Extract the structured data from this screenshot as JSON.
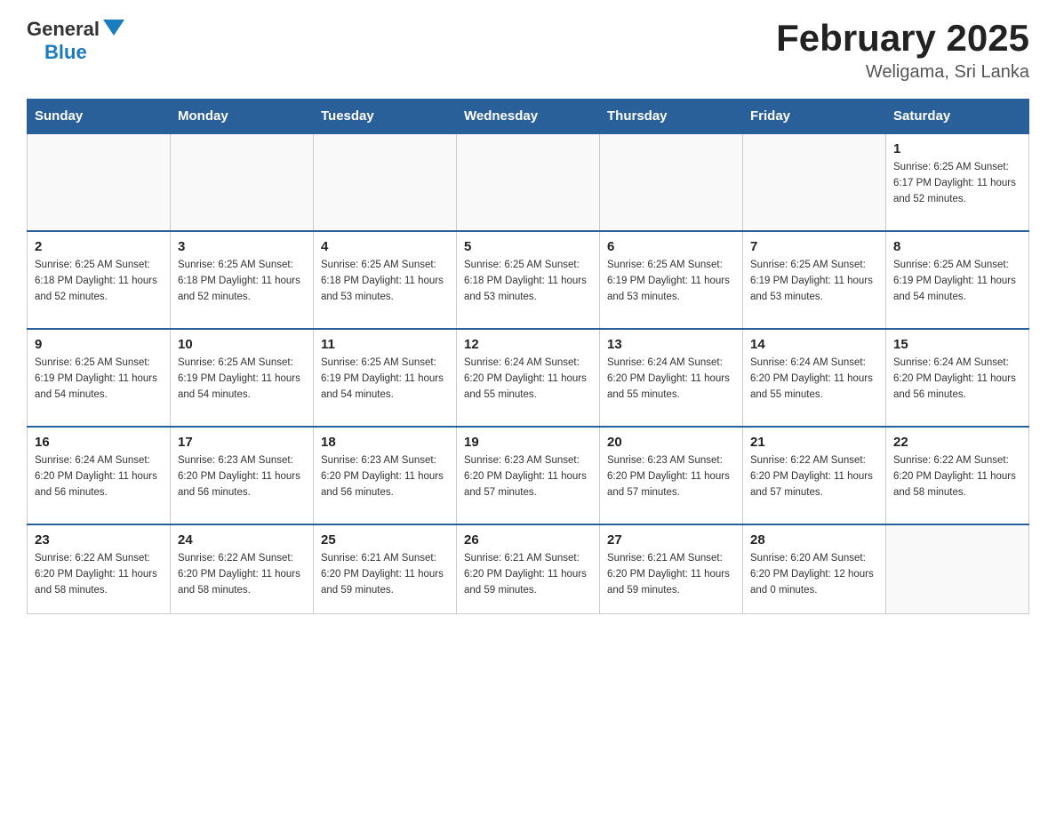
{
  "header": {
    "logo_general": "General",
    "logo_blue": "Blue",
    "title": "February 2025",
    "location": "Weligama, Sri Lanka"
  },
  "days_of_week": [
    "Sunday",
    "Monday",
    "Tuesday",
    "Wednesday",
    "Thursday",
    "Friday",
    "Saturday"
  ],
  "weeks": [
    [
      {
        "day": "",
        "info": ""
      },
      {
        "day": "",
        "info": ""
      },
      {
        "day": "",
        "info": ""
      },
      {
        "day": "",
        "info": ""
      },
      {
        "day": "",
        "info": ""
      },
      {
        "day": "",
        "info": ""
      },
      {
        "day": "1",
        "info": "Sunrise: 6:25 AM\nSunset: 6:17 PM\nDaylight: 11 hours\nand 52 minutes."
      }
    ],
    [
      {
        "day": "2",
        "info": "Sunrise: 6:25 AM\nSunset: 6:18 PM\nDaylight: 11 hours\nand 52 minutes."
      },
      {
        "day": "3",
        "info": "Sunrise: 6:25 AM\nSunset: 6:18 PM\nDaylight: 11 hours\nand 52 minutes."
      },
      {
        "day": "4",
        "info": "Sunrise: 6:25 AM\nSunset: 6:18 PM\nDaylight: 11 hours\nand 53 minutes."
      },
      {
        "day": "5",
        "info": "Sunrise: 6:25 AM\nSunset: 6:18 PM\nDaylight: 11 hours\nand 53 minutes."
      },
      {
        "day": "6",
        "info": "Sunrise: 6:25 AM\nSunset: 6:19 PM\nDaylight: 11 hours\nand 53 minutes."
      },
      {
        "day": "7",
        "info": "Sunrise: 6:25 AM\nSunset: 6:19 PM\nDaylight: 11 hours\nand 53 minutes."
      },
      {
        "day": "8",
        "info": "Sunrise: 6:25 AM\nSunset: 6:19 PM\nDaylight: 11 hours\nand 54 minutes."
      }
    ],
    [
      {
        "day": "9",
        "info": "Sunrise: 6:25 AM\nSunset: 6:19 PM\nDaylight: 11 hours\nand 54 minutes."
      },
      {
        "day": "10",
        "info": "Sunrise: 6:25 AM\nSunset: 6:19 PM\nDaylight: 11 hours\nand 54 minutes."
      },
      {
        "day": "11",
        "info": "Sunrise: 6:25 AM\nSunset: 6:19 PM\nDaylight: 11 hours\nand 54 minutes."
      },
      {
        "day": "12",
        "info": "Sunrise: 6:24 AM\nSunset: 6:20 PM\nDaylight: 11 hours\nand 55 minutes."
      },
      {
        "day": "13",
        "info": "Sunrise: 6:24 AM\nSunset: 6:20 PM\nDaylight: 11 hours\nand 55 minutes."
      },
      {
        "day": "14",
        "info": "Sunrise: 6:24 AM\nSunset: 6:20 PM\nDaylight: 11 hours\nand 55 minutes."
      },
      {
        "day": "15",
        "info": "Sunrise: 6:24 AM\nSunset: 6:20 PM\nDaylight: 11 hours\nand 56 minutes."
      }
    ],
    [
      {
        "day": "16",
        "info": "Sunrise: 6:24 AM\nSunset: 6:20 PM\nDaylight: 11 hours\nand 56 minutes."
      },
      {
        "day": "17",
        "info": "Sunrise: 6:23 AM\nSunset: 6:20 PM\nDaylight: 11 hours\nand 56 minutes."
      },
      {
        "day": "18",
        "info": "Sunrise: 6:23 AM\nSunset: 6:20 PM\nDaylight: 11 hours\nand 56 minutes."
      },
      {
        "day": "19",
        "info": "Sunrise: 6:23 AM\nSunset: 6:20 PM\nDaylight: 11 hours\nand 57 minutes."
      },
      {
        "day": "20",
        "info": "Sunrise: 6:23 AM\nSunset: 6:20 PM\nDaylight: 11 hours\nand 57 minutes."
      },
      {
        "day": "21",
        "info": "Sunrise: 6:22 AM\nSunset: 6:20 PM\nDaylight: 11 hours\nand 57 minutes."
      },
      {
        "day": "22",
        "info": "Sunrise: 6:22 AM\nSunset: 6:20 PM\nDaylight: 11 hours\nand 58 minutes."
      }
    ],
    [
      {
        "day": "23",
        "info": "Sunrise: 6:22 AM\nSunset: 6:20 PM\nDaylight: 11 hours\nand 58 minutes."
      },
      {
        "day": "24",
        "info": "Sunrise: 6:22 AM\nSunset: 6:20 PM\nDaylight: 11 hours\nand 58 minutes."
      },
      {
        "day": "25",
        "info": "Sunrise: 6:21 AM\nSunset: 6:20 PM\nDaylight: 11 hours\nand 59 minutes."
      },
      {
        "day": "26",
        "info": "Sunrise: 6:21 AM\nSunset: 6:20 PM\nDaylight: 11 hours\nand 59 minutes."
      },
      {
        "day": "27",
        "info": "Sunrise: 6:21 AM\nSunset: 6:20 PM\nDaylight: 11 hours\nand 59 minutes."
      },
      {
        "day": "28",
        "info": "Sunrise: 6:20 AM\nSunset: 6:20 PM\nDaylight: 12 hours\nand 0 minutes."
      },
      {
        "day": "",
        "info": ""
      }
    ]
  ]
}
